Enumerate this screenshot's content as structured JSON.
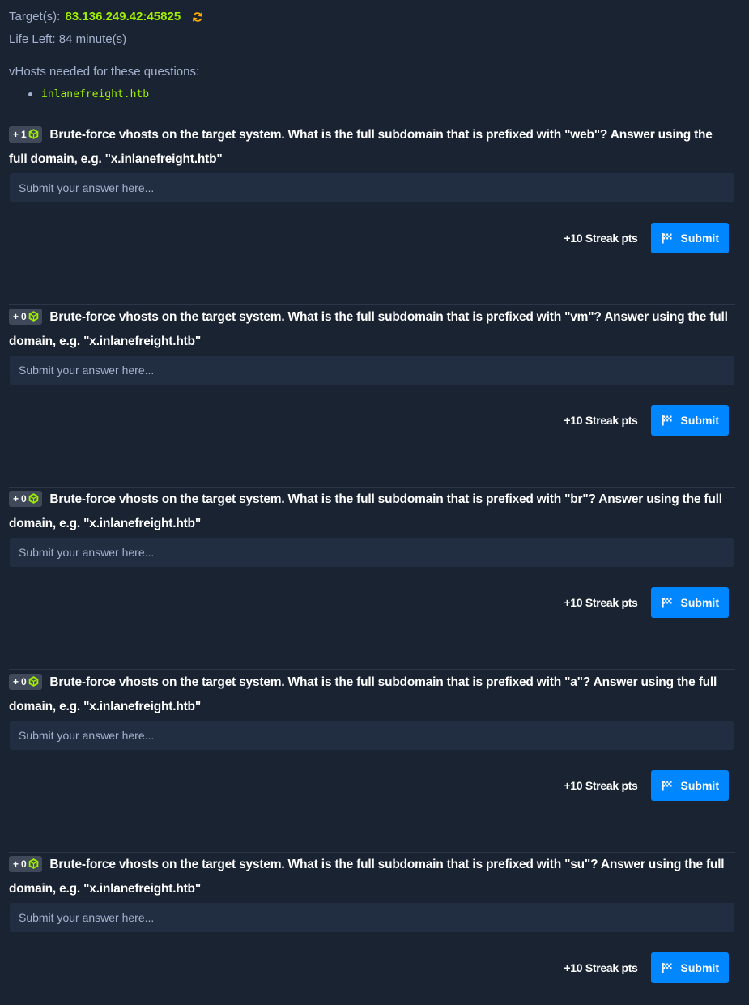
{
  "header": {
    "target_label": "Target(s):",
    "target_value": "83.136.249.42:45825",
    "life_label": "Life Left:",
    "life_value": "84 minute(s)",
    "vhosts_label": "vHosts needed for these questions:",
    "vhosts": [
      "inlanefreight.htb"
    ]
  },
  "colors": {
    "background": "#1a2332",
    "accent_green": "#9fef00",
    "submit_blue": "#0086ff",
    "input_bg": "#212e41"
  },
  "icons": {
    "refresh": "refresh-icon",
    "badge": "cube-icon",
    "submit": "flag-icon"
  },
  "questions": [
    {
      "badge": "+ 1",
      "text": "Brute-force vhosts on the target system. What is the full subdomain that is prefixed with \"web\"? Answer using the full domain, e.g. \"x.inlanefreight.htb\"",
      "placeholder": "Submit your answer here...",
      "streak": "+10 Streak pts",
      "submit_label": "Submit"
    },
    {
      "badge": "+ 0",
      "text": "Brute-force vhosts on the target system. What is the full subdomain that is prefixed with \"vm\"? Answer using the full domain, e.g. \"x.inlanefreight.htb\"",
      "placeholder": "Submit your answer here...",
      "streak": "+10 Streak pts",
      "submit_label": "Submit"
    },
    {
      "badge": "+ 0",
      "text": "Brute-force vhosts on the target system. What is the full subdomain that is prefixed with \"br\"? Answer using the full domain, e.g. \"x.inlanefreight.htb\"",
      "placeholder": "Submit your answer here...",
      "streak": "+10 Streak pts",
      "submit_label": "Submit"
    },
    {
      "badge": "+ 0",
      "text": "Brute-force vhosts on the target system. What is the full subdomain that is prefixed with \"a\"? Answer using the full domain, e.g. \"x.inlanefreight.htb\"",
      "placeholder": "Submit your answer here...",
      "streak": "+10 Streak pts",
      "submit_label": "Submit"
    },
    {
      "badge": "+ 0",
      "text": "Brute-force vhosts on the target system. What is the full subdomain that is prefixed with \"su\"? Answer using the full domain, e.g. \"x.inlanefreight.htb\"",
      "placeholder": "Submit your answer here...",
      "streak": "+10 Streak pts",
      "submit_label": "Submit"
    }
  ]
}
